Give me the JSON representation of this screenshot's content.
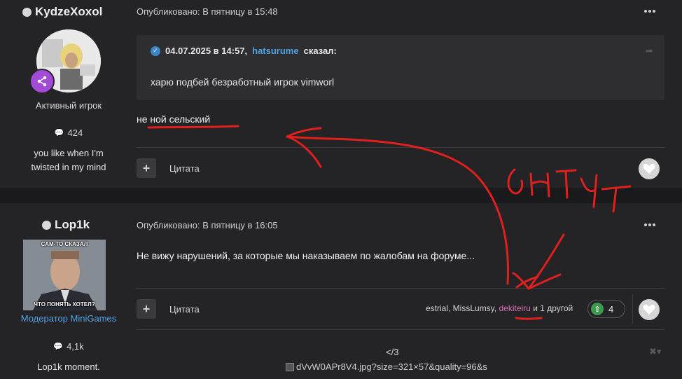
{
  "post1": {
    "username": "KydzeXoxol",
    "role": "Активный игрок",
    "post_count": "424",
    "signature_line1": "you like when I'm",
    "signature_line2": "twisted in my mind",
    "published": "Опубликовано: В пятницу в 15:48",
    "quote": {
      "date": "04.07.2025 в 14:57,",
      "user": "hatsurume",
      "said": "сказал:",
      "text": "харю подбей безработный игрок vimworl"
    },
    "body": "не ной сельский",
    "cite_label": "Цитата"
  },
  "post2": {
    "username": "Lop1k",
    "photo_caption_top": "САМ-ТО СКАЗАЛ",
    "photo_caption_bottom": "ЧТО ПОНЯТЬ ХОТЕЛ?",
    "role": "Модератор MiniGames",
    "post_count": "4,1k",
    "signature": "Lop1k moment.",
    "published": "Опубликовано: В пятницу в 16:05",
    "body": "Не вижу нарушений, за которые мы наказываем по жалобам на форуме...",
    "cite_label": "Цитата",
    "reactors": {
      "names": "estrial, MissLumsy,",
      "highlight": "dekiteiru",
      "rest": "и 1 другой"
    },
    "reputation": "4",
    "sig_text": "</3",
    "sig_image_alt": "dVvW0APr8V4.jpg?size=321×57&quality=96&s"
  },
  "annotation": {
    "scrawl": "онтут",
    "color": "#e01f1f"
  },
  "colors": {
    "accent_blue": "#4ea3e6",
    "badge_purple": "#a34ad6",
    "rep_green": "#3e9a4e",
    "pink": "#d56fb5"
  }
}
